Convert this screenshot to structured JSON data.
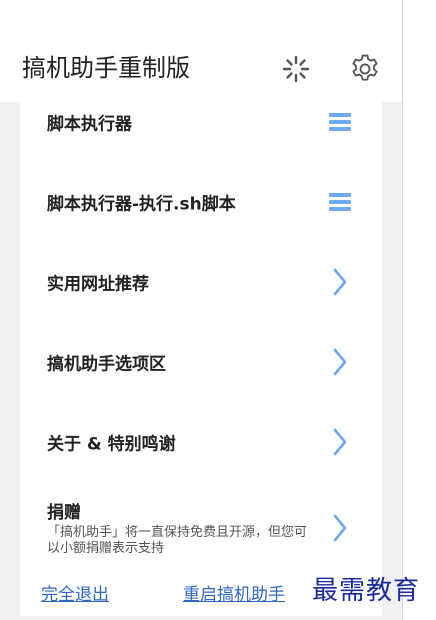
{
  "header": {
    "title": "搞机助手重制版",
    "loading_icon": "spinner-icon",
    "settings_icon": "gear-icon"
  },
  "menu": {
    "items": [
      {
        "label": "脚本执行器",
        "icon": "menu-icon"
      },
      {
        "label": "脚本执行器-执行.sh脚本",
        "icon": "menu-icon"
      },
      {
        "label": "实用网址推荐",
        "icon": "chevron-right-icon"
      },
      {
        "label": "搞机助手选项区",
        "icon": "chevron-right-icon"
      },
      {
        "label": "关于 & 特别鸣谢",
        "icon": "chevron-right-icon"
      }
    ],
    "donate": {
      "label": "捐赠",
      "description": "「搞机助手」将一直保持免费且开源，但您可以小额捐赠表示支持",
      "icon": "chevron-right-icon"
    }
  },
  "footer": {
    "exit_label": "完全退出",
    "restart_label": "重启搞机助手"
  },
  "watermark": "最需教育",
  "colors": {
    "accent": "#6fa8f2",
    "link": "#2f66c4",
    "watermark": "#1c2aa0",
    "background": "#f1f1f1"
  }
}
